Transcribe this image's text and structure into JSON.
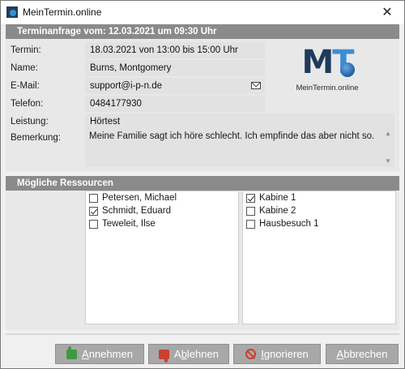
{
  "window": {
    "title": "MeinTermin.online",
    "close_glyph": "✕"
  },
  "request": {
    "header": "Terminanfrage vom: 12.03.2021 um 09:30 Uhr",
    "labels": {
      "termin": "Termin:",
      "name": "Name:",
      "email": "E-Mail:",
      "telefon": "Telefon:",
      "leistung": "Leistung:",
      "bemerkung": "Bemerkung:"
    },
    "values": {
      "termin": "18.03.2021 von 13:00 bis 15:00 Uhr",
      "name": "Burns, Montgomery",
      "email": "support@i-p-n.de",
      "telefon": "0484177930",
      "leistung": "Hörtest",
      "bemerkung": "Meine Familie sagt ich höre schlecht. Ich empfinde das aber nicht so."
    },
    "logo": {
      "mark_m": "M",
      "mark_t": "T",
      "subtitle": "MeinTermin.online"
    }
  },
  "resources": {
    "header": "Mögliche Ressourcen",
    "staff": [
      {
        "label": "Petersen, Michael",
        "checked": false
      },
      {
        "label": "Schmidt, Eduard",
        "checked": true
      },
      {
        "label": "Teweleit, Ilse",
        "checked": false
      }
    ],
    "rooms": [
      {
        "label": "Kabine 1",
        "checked": true
      },
      {
        "label": "Kabine 2",
        "checked": false
      },
      {
        "label": "Hausbesuch 1",
        "checked": false
      }
    ]
  },
  "buttons": {
    "accept": {
      "mnemonic": "A",
      "rest": "nnehmen"
    },
    "reject": {
      "prefix": "A",
      "mnemonic": "b",
      "rest": "lehnen"
    },
    "ignore": {
      "mnemonic": "I",
      "rest": "gnorieren"
    },
    "cancel": {
      "mnemonic": "A",
      "rest": "bbrechen"
    }
  },
  "colors": {
    "header_bg": "#8a8a8a",
    "button_bg": "#a8a8a8",
    "logo_dark": "#1e3a5c",
    "logo_blue": "#3b8ed4"
  }
}
